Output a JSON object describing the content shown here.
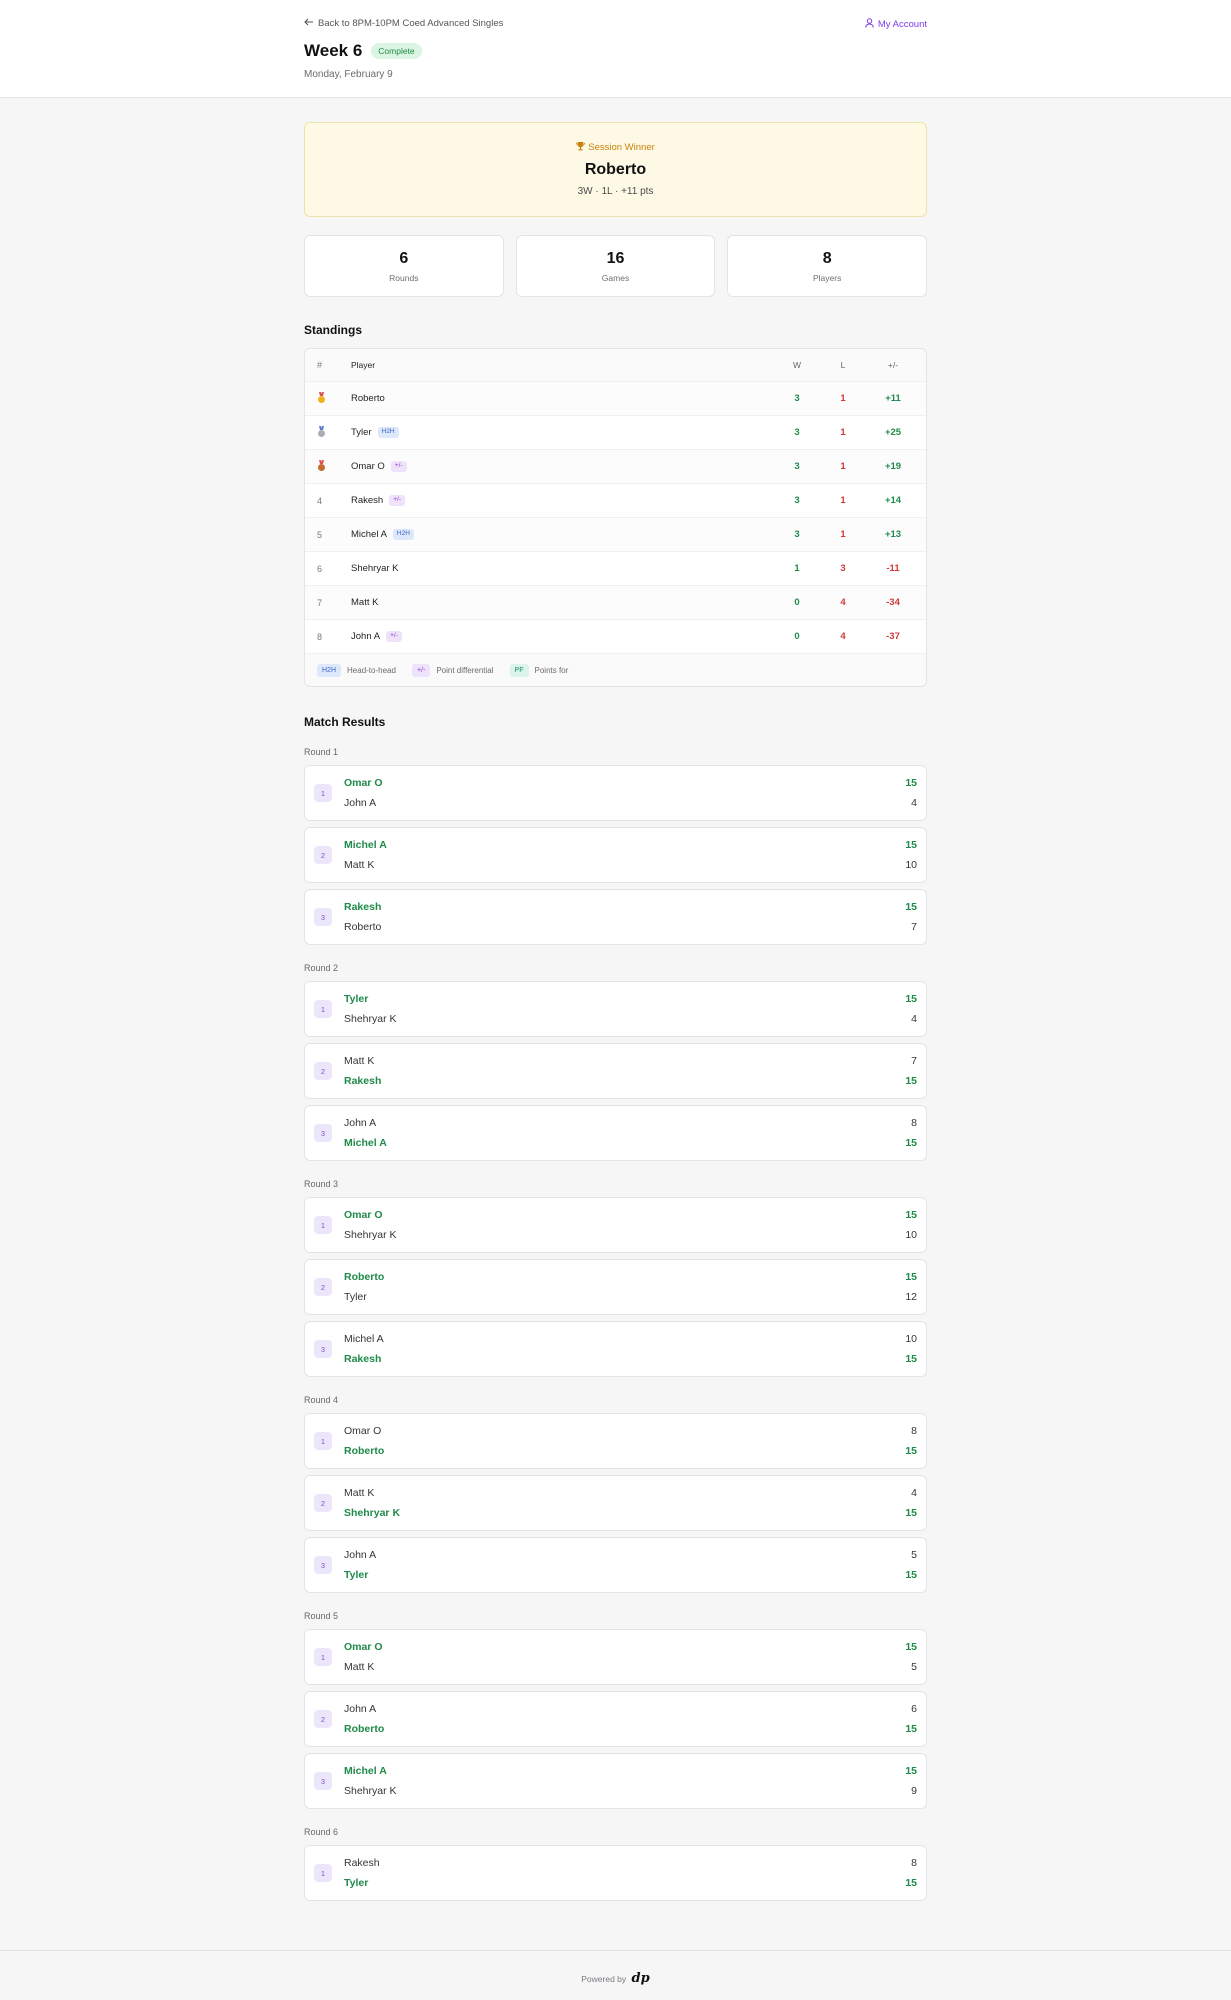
{
  "header": {
    "back_label": "Back to 8PM-10PM Coed Advanced Singles",
    "account_label": "My Account",
    "title": "Week 6",
    "status": "Complete",
    "date": "Monday, February 9"
  },
  "winner": {
    "label": "Session Winner",
    "name": "Roberto",
    "stats": "3W · 1L · +11 pts"
  },
  "summary": [
    {
      "value": "6",
      "label": "Rounds"
    },
    {
      "value": "16",
      "label": "Games"
    },
    {
      "value": "8",
      "label": "Players"
    }
  ],
  "standings": {
    "title": "Standings",
    "columns": {
      "rank": "#",
      "player": "Player",
      "w": "W",
      "l": "L",
      "pd": "+/-"
    },
    "rows": [
      {
        "rank": "1",
        "medal": "gold",
        "player": "Roberto",
        "tag": "",
        "w": "3",
        "l": "1",
        "pd": "+11"
      },
      {
        "rank": "2",
        "medal": "silver",
        "player": "Tyler",
        "tag": "H2H",
        "w": "3",
        "l": "1",
        "pd": "+25"
      },
      {
        "rank": "3",
        "medal": "bronze",
        "player": "Omar O",
        "tag": "+/-",
        "w": "3",
        "l": "1",
        "pd": "+19"
      },
      {
        "rank": "4",
        "medal": "",
        "player": "Rakesh",
        "tag": "+/-",
        "w": "3",
        "l": "1",
        "pd": "+14"
      },
      {
        "rank": "5",
        "medal": "",
        "player": "Michel A",
        "tag": "H2H",
        "w": "3",
        "l": "1",
        "pd": "+13"
      },
      {
        "rank": "6",
        "medal": "",
        "player": "Shehryar K",
        "tag": "",
        "w": "1",
        "l": "3",
        "pd": "-11"
      },
      {
        "rank": "7",
        "medal": "",
        "player": "Matt K",
        "tag": "",
        "w": "0",
        "l": "4",
        "pd": "-34"
      },
      {
        "rank": "8",
        "medal": "",
        "player": "John A",
        "tag": "+/-",
        "w": "0",
        "l": "4",
        "pd": "-37"
      }
    ],
    "legend": [
      {
        "tag": "H2H",
        "text": "Head-to-head"
      },
      {
        "tag": "+/-",
        "text": "Point differential"
      },
      {
        "tag": "PF",
        "text": "Points for"
      }
    ]
  },
  "results": {
    "title": "Match Results",
    "rounds": [
      {
        "label": "Round 1",
        "matches": [
          {
            "num": "1",
            "a": "Omar O",
            "as": "15",
            "b": "John A",
            "bs": "4",
            "winner": "a"
          },
          {
            "num": "2",
            "a": "Michel A",
            "as": "15",
            "b": "Matt K",
            "bs": "10",
            "winner": "a"
          },
          {
            "num": "3",
            "a": "Rakesh",
            "as": "15",
            "b": "Roberto",
            "bs": "7",
            "winner": "a"
          }
        ]
      },
      {
        "label": "Round 2",
        "matches": [
          {
            "num": "1",
            "a": "Tyler",
            "as": "15",
            "b": "Shehryar K",
            "bs": "4",
            "winner": "a"
          },
          {
            "num": "2",
            "a": "Matt K",
            "as": "7",
            "b": "Rakesh",
            "bs": "15",
            "winner": "b"
          },
          {
            "num": "3",
            "a": "John A",
            "as": "8",
            "b": "Michel A",
            "bs": "15",
            "winner": "b"
          }
        ]
      },
      {
        "label": "Round 3",
        "matches": [
          {
            "num": "1",
            "a": "Omar O",
            "as": "15",
            "b": "Shehryar K",
            "bs": "10",
            "winner": "a"
          },
          {
            "num": "2",
            "a": "Roberto",
            "as": "15",
            "b": "Tyler",
            "bs": "12",
            "winner": "a"
          },
          {
            "num": "3",
            "a": "Michel A",
            "as": "10",
            "b": "Rakesh",
            "bs": "15",
            "winner": "b"
          }
        ]
      },
      {
        "label": "Round 4",
        "matches": [
          {
            "num": "1",
            "a": "Omar O",
            "as": "8",
            "b": "Roberto",
            "bs": "15",
            "winner": "b"
          },
          {
            "num": "2",
            "a": "Matt K",
            "as": "4",
            "b": "Shehryar K",
            "bs": "15",
            "winner": "b"
          },
          {
            "num": "3",
            "a": "John A",
            "as": "5",
            "b": "Tyler",
            "bs": "15",
            "winner": "b"
          }
        ]
      },
      {
        "label": "Round 5",
        "matches": [
          {
            "num": "1",
            "a": "Omar O",
            "as": "15",
            "b": "Matt K",
            "bs": "5",
            "winner": "a"
          },
          {
            "num": "2",
            "a": "John A",
            "as": "6",
            "b": "Roberto",
            "bs": "15",
            "winner": "b"
          },
          {
            "num": "3",
            "a": "Michel A",
            "as": "15",
            "b": "Shehryar K",
            "bs": "9",
            "winner": "a"
          }
        ]
      },
      {
        "label": "Round 6",
        "matches": [
          {
            "num": "1",
            "a": "Rakesh",
            "as": "8",
            "b": "Tyler",
            "bs": "15",
            "winner": "b"
          }
        ]
      }
    ]
  },
  "footer": {
    "powered_by": "Powered by",
    "logo_text": "dp"
  },
  "colors": {
    "accent": "#7c3aed",
    "win": "#1f8a49",
    "loss": "#d23a3a",
    "winner_bg": "#fdf9e4"
  },
  "icons": {
    "back": "arrow-left-icon",
    "account": "user-icon",
    "trophy": "trophy-icon"
  }
}
